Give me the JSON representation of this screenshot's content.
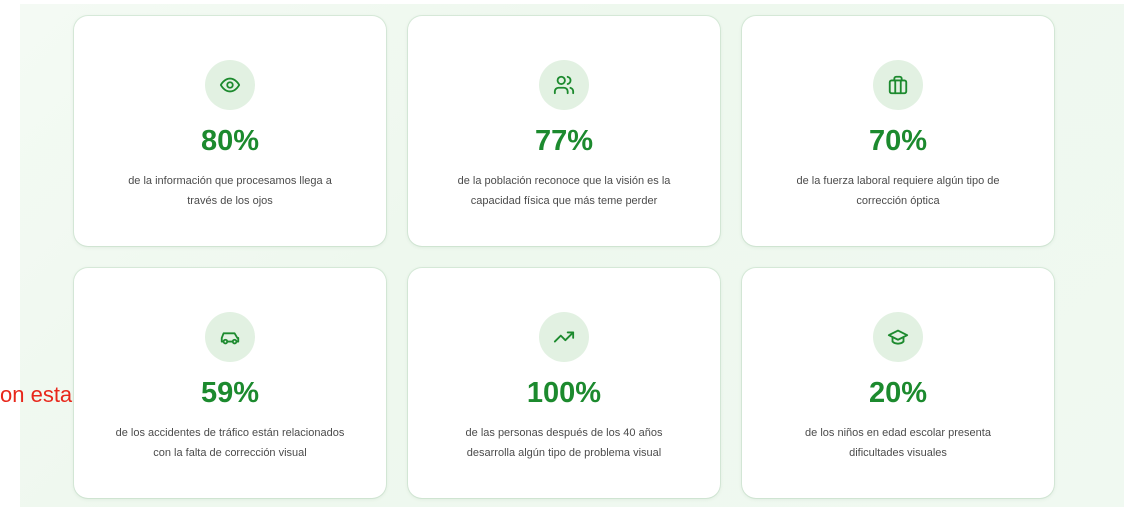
{
  "side_text": "on esta",
  "colors": {
    "accent": "#1c8a2e",
    "icon_background": "#e2f1e2",
    "side_text": "#e8271b"
  },
  "cards": [
    {
      "icon": "eye-icon",
      "value": "80%",
      "line1": "de la información que procesamos llega a",
      "line2": "través de los ojos"
    },
    {
      "icon": "users-icon",
      "value": "77%",
      "line1": "de la población reconoce que la visión es la",
      "line2": "capacidad física que más teme perder"
    },
    {
      "icon": "briefcase-icon",
      "value": "70%",
      "line1": "de la fuerza laboral requiere algún tipo de",
      "line2": "corrección óptica"
    },
    {
      "icon": "car-icon",
      "value": "59%",
      "line1": "de los accidentes de tráfico están relacionados",
      "line2": "con la falta de corrección visual"
    },
    {
      "icon": "trending-up-icon",
      "value": "100%",
      "line1": "de las personas después de los 40 años",
      "line2": "desarrolla algún tipo de problema visual"
    },
    {
      "icon": "graduation-cap-icon",
      "value": "20%",
      "line1": "de los niños en edad escolar presenta",
      "line2": "dificultades visuales"
    }
  ]
}
